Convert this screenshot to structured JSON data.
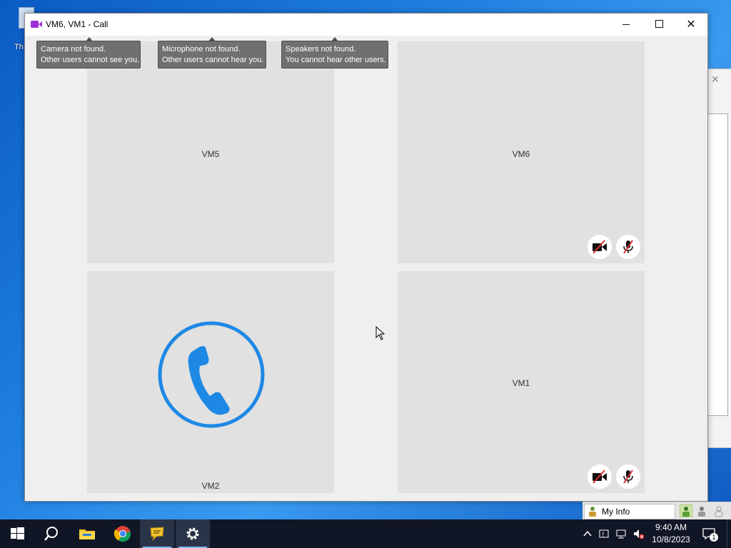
{
  "window": {
    "title": "VM6, VM1 - Call",
    "controls": {
      "minimize": "minimize",
      "maximize": "maximize",
      "close": "close"
    }
  },
  "tooltips": [
    {
      "line1": "Camera not found.",
      "line2": "Other users cannot see you."
    },
    {
      "line1": "Microphone not found.",
      "line2": "Other users cannot hear you."
    },
    {
      "line1": "Speakers not found.",
      "line2": "You cannot hear other users."
    }
  ],
  "tiles": {
    "vm5": {
      "label": "VM5"
    },
    "vm6": {
      "label": "VM6",
      "camera_off": true,
      "mic_off": true
    },
    "vm2": {
      "label": "VM2",
      "calling": true
    },
    "vm1": {
      "label": "VM1",
      "camera_off": true,
      "mic_off": true
    }
  },
  "desktop": {
    "icon_label": "Th"
  },
  "myinfo": {
    "label": "My Info"
  },
  "taskbar": {
    "apps": [
      "start-icon",
      "search-icon",
      "file-explorer-icon",
      "chrome-icon",
      "chat-app-icon",
      "settings-icon"
    ],
    "clock_time": "9:40 AM",
    "clock_date": "10/8/2023",
    "notification_count": "1"
  },
  "colors": {
    "accent_blue": "#1e88e5",
    "call_icon_purple": "#9b30d9",
    "muted_red": "#e03030",
    "tooltip_bg": "#707070",
    "tile_bg": "#e1e1e1"
  }
}
